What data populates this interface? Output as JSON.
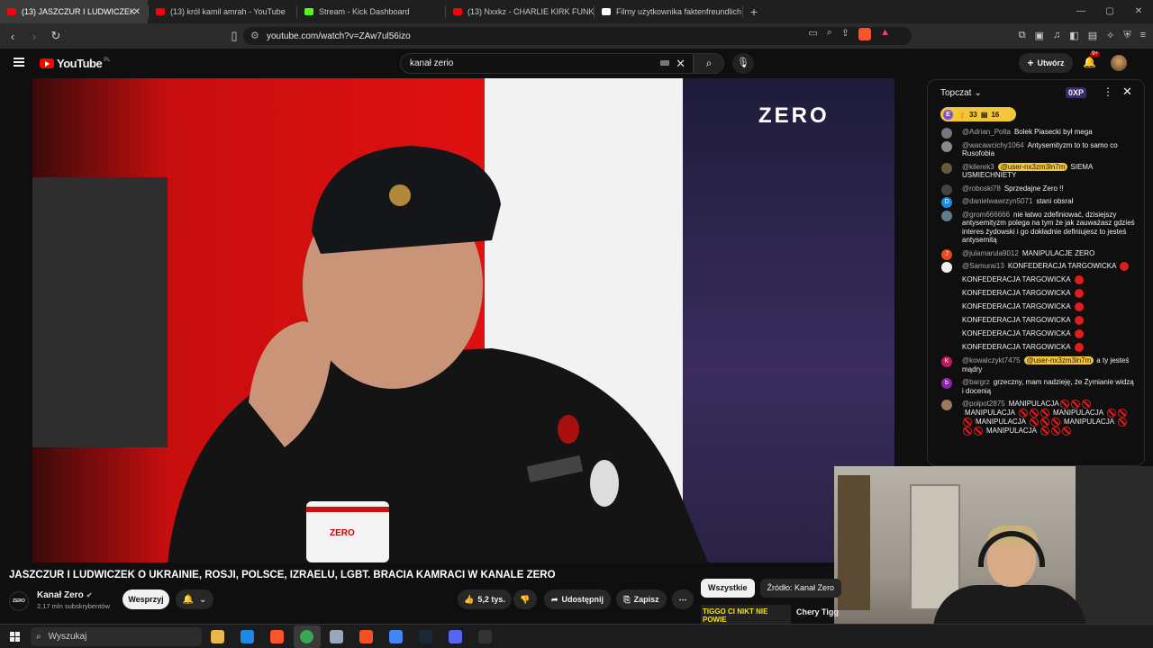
{
  "browser": {
    "tabs": [
      {
        "label": "(13) JASZCZUR I LUDWICZEK",
        "color": "#ff0000",
        "active": true
      },
      {
        "label": "(13) król kamil amrah - YouTube",
        "color": "#ff0000",
        "active": false
      },
      {
        "label": "Stream - Kick Dashboard",
        "color": "#53fc18",
        "active": false
      },
      {
        "label": "(13) Nxxkz - CHARLIE KIRK FUNK (Of",
        "color": "#ff0000",
        "active": false
      },
      {
        "label": "Filmy użytkownika faktenfreundlich",
        "color": "#ffffff",
        "active": false
      }
    ],
    "new_tab": "+",
    "url": "youtube.com/watch?v=ZAw7ul56izo"
  },
  "youtube": {
    "logo_text": "YouTube",
    "region": "PL",
    "search_value": "kanał zerio",
    "create_label": "Utwórz",
    "notif_badge": "9+"
  },
  "video": {
    "overlay_logo": "ZERO",
    "mug_text": "ZERO"
  },
  "chat": {
    "header": "Topczat",
    "xp": "0XP",
    "pill_initial": "E",
    "pill_likes": "33",
    "pill_msgs": "16",
    "messages": [
      {
        "user": "@Adrian_Polta",
        "text": "Bolek Piasecki był mega",
        "avatar_color": "#777777",
        "avatar": ""
      },
      {
        "user": "@wacawcichy1064",
        "text": "Antysemityzm to to samo co Rusofobia",
        "avatar_color": "#8a8a8a",
        "avatar": ""
      },
      {
        "user": "@kilerek3",
        "mention": "@user-nx3zm3ln7m",
        "text": "SIEMA USMIECHNIETY",
        "avatar_color": "#6a5a3a",
        "avatar": ""
      },
      {
        "user": "@roboski78",
        "text": "Sprzedajne Zero !!",
        "avatar_color": "#444444",
        "avatar": ""
      },
      {
        "user": "@danielwawrzyn5071",
        "text": "stani obsrał",
        "avatar_color": "#1e88e5",
        "avatar": "D"
      },
      {
        "user": "@grom666666",
        "text": "nie łatwo zdefiniować, dzisiejszy antysemityzm polega na tym że jak zauważasz gdzieś interes żydowski i go dokładnie definiujesz to jesteś antysemitą",
        "avatar_color": "#607d8b",
        "avatar": ""
      },
      {
        "user": "@julamarula9012",
        "text": "MANIPULACJE ZERO",
        "avatar_color": "#e64a19",
        "avatar": "J"
      },
      {
        "user": "@Samurai13",
        "text": "KONFEDERACJA TARGOWICKA",
        "avatar_color": "#eeeeee",
        "avatar": ""
      },
      {
        "user": "",
        "text": "KONFEDERACJA TARGOWICKA",
        "avatar_color": "",
        "avatar": ""
      },
      {
        "user": "",
        "text": "KONFEDERACJA TARGOWICKA",
        "avatar_color": "",
        "avatar": ""
      },
      {
        "user": "",
        "text": "KONFEDERACJA TARGOWICKA",
        "avatar_color": "",
        "avatar": ""
      },
      {
        "user": "",
        "text": "KONFEDERACJA TARGOWICKA",
        "avatar_color": "",
        "avatar": ""
      },
      {
        "user": "",
        "text": "KONFEDERACJA TARGOWICKA",
        "avatar_color": "",
        "avatar": ""
      },
      {
        "user": "",
        "text": "KONFEDERACJA TARGOWICKA",
        "avatar_color": "",
        "avatar": ""
      },
      {
        "user": "@kowalczykt7475",
        "mention": "@user-nx3zm3ln7m",
        "text": "a ty jesteś mądry",
        "avatar_color": "#c2185b",
        "avatar": "K"
      },
      {
        "user": "@bargrz",
        "text": "grzeczny, mam nadzieję, że Żymianie widzą i docenią",
        "avatar_color": "#8e24aa",
        "avatar": "b"
      },
      {
        "user": "@polpot2875",
        "text": "MANIPULACJA",
        "avatar_color": "#a0785a",
        "avatar": ""
      }
    ],
    "manip_word": "MANIPULACJA"
  },
  "meta": {
    "title": "JASZCZUR I LUDWICZEK O UKRAINIE, ROSJI, POLSCE, IZRAELU, LGBT. BRACIA KAMRACI W KANALE ZERO",
    "channel_avatar": "ZERO",
    "channel": "Kanał Zero",
    "subscribers": "2,17 mln subskrybentów",
    "support_label": "Wesprzyj",
    "likes": "5,2 tys.",
    "share_label": "Udostępnij",
    "save_label": "Zapisz",
    "chips": [
      "Wszystkie",
      "Źródło: Kanał Zero"
    ],
    "rec_thumb_text": "TIGGO CI NIKT NIE POWIE",
    "rec_title": "Chery Tigg"
  },
  "taskbar": {
    "search_label": "Wyszukaj",
    "icons": [
      "#e8b84a",
      "#1e88e5",
      "#fb542b",
      "#34a853",
      "#9aa7b8",
      "#f4511e",
      "#4285f4",
      "#1b2838",
      "#5865f2",
      "#333333"
    ]
  }
}
